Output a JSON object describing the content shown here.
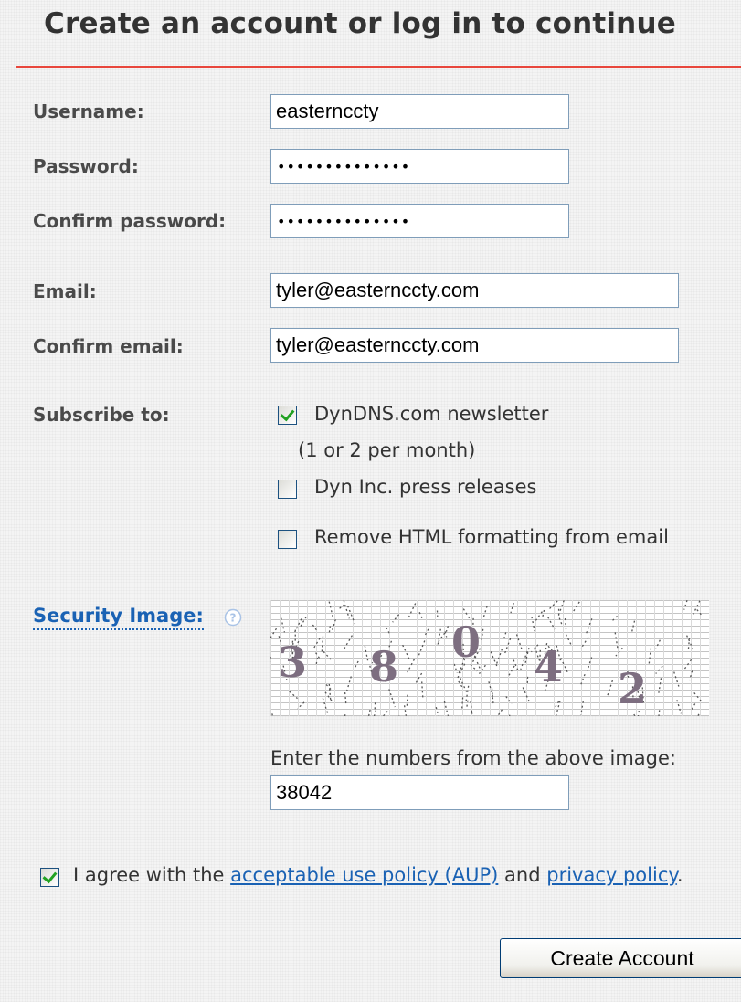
{
  "page": {
    "title": "Create an account or log in to continue"
  },
  "form": {
    "username": {
      "label": "Username:",
      "value": "easternccty"
    },
    "password": {
      "label": "Password:",
      "value": "••••••••••••••"
    },
    "confirm_password": {
      "label": "Confirm password:",
      "value": "••••••••••••••"
    },
    "email": {
      "label": "Email:",
      "value": "tyler@easternccty.com"
    },
    "confirm_email": {
      "label": "Confirm email:",
      "value": "tyler@easternccty.com"
    }
  },
  "subscribe": {
    "label": "Subscribe to:",
    "options": [
      {
        "label": "DynDNS.com newsletter",
        "note": "(1 or 2 per month)",
        "checked": true
      },
      {
        "label": "Dyn Inc. press releases",
        "checked": false
      },
      {
        "label": "Remove HTML formatting from email",
        "checked": false
      }
    ]
  },
  "security": {
    "label": "Security Image:",
    "help_icon": "question-circle-icon",
    "captcha_digits": [
      "3",
      "8",
      "0",
      "4",
      "2"
    ],
    "prompt": "Enter the numbers from the above image:",
    "value": "38042"
  },
  "agreement": {
    "checked": true,
    "prefix": "I agree with the",
    "aup_link": "acceptable use policy (AUP)",
    "conjunction": "and",
    "privacy_link": "privacy policy",
    "suffix": "."
  },
  "actions": {
    "create_label": "Create Account"
  },
  "colors": {
    "accent_rule": "#e8463c",
    "link": "#1a62b4",
    "check": "#21a121"
  }
}
